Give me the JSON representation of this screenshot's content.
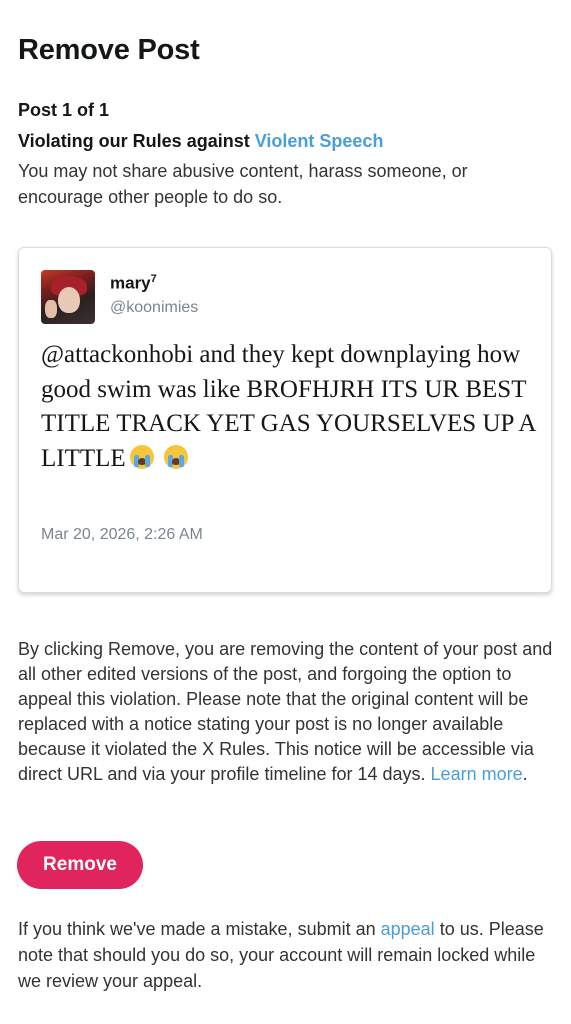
{
  "page_title": "Remove Post",
  "post_count": "Post 1 of 1",
  "violation": {
    "heading_prefix": "Violating our Rules against",
    "rule_link": "Violent Speech",
    "description": "You may not share abusive content, harass someone, or encourage other people to do so."
  },
  "tweet": {
    "display_name": "mary",
    "display_name_sup": "7",
    "handle": "@koonimies",
    "text": "@attackonhobi and they kept downplaying how good swim was like BROFHJRH ITS UR BEST TITLE TRACK YET GAS YOURSELVES UP A LITTLE",
    "emoji_icon": "loudly-crying-face-icon",
    "timestamp": "Mar 20, 2026, 2:26 AM"
  },
  "notice": {
    "text": "By clicking Remove, you are removing the content of your post and all other edited versions of the post, and forgoing the option to appeal this violation. Please note that the original content will be replaced with a notice stating your post is no longer available because it violated the X Rules. This notice will be accessible via direct URL and via your profile timeline for 14 days.",
    "learn_more_link": "Learn more",
    "end_punct": "."
  },
  "remove_button_label": "Remove",
  "appeal": {
    "text_before": "If you think we've made a mistake, submit an",
    "link": "appeal",
    "text_after": "to us. Please note that should you do so, your account will remain locked while we review your appeal."
  },
  "colors": {
    "link": "#4a9ddb",
    "remove_button": "#e0245e",
    "secondary_text": "#7b8591"
  }
}
